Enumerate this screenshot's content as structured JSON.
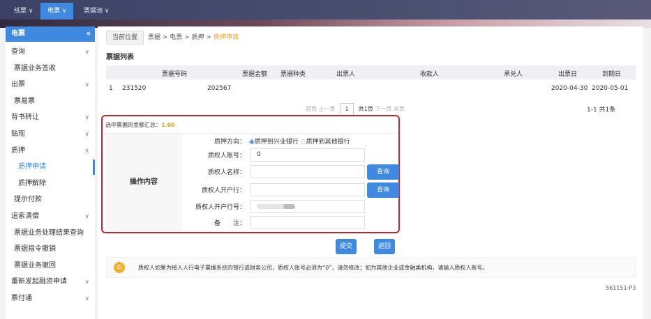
{
  "topnav": [
    {
      "label": "纸票"
    },
    {
      "label": "电票"
    },
    {
      "label": "票据池"
    }
  ],
  "sidebar": {
    "title": "电票",
    "collapse_icon": "«",
    "items": [
      {
        "label": "查询",
        "chev": true
      },
      {
        "label": "票据业务签收"
      },
      {
        "label": "出票",
        "chev": true
      },
      {
        "label": "票易票"
      },
      {
        "label": "背书转让",
        "chev": true
      },
      {
        "label": "贴现",
        "chev": true
      },
      {
        "label": "质押",
        "chev": true,
        "open": true
      },
      {
        "label": "质押申请",
        "active": true
      },
      {
        "label": "质押解除"
      },
      {
        "label": "提示付款"
      },
      {
        "label": "追索清偿",
        "chev": true
      },
      {
        "label": "票据业务处理结果查询"
      },
      {
        "label": "票据指令撤销"
      },
      {
        "label": "票据业务撤回"
      },
      {
        "label": "重新发起融资申请",
        "chev": true
      },
      {
        "label": "票付通",
        "chev": true
      }
    ]
  },
  "breadcrumb": {
    "here": "当前位置",
    "path": "票据 > 电票 > 质押 > ",
    "current": "质押申请"
  },
  "table": {
    "title": "票据列表",
    "headers": [
      "票据号码",
      "票据金额",
      "票据种类",
      "出票人",
      "收款人",
      "承兑人",
      "出票日",
      "到期日"
    ],
    "rows": [
      {
        "idx": "1",
        "no_start": "231520",
        "no_end": "202567",
        "issue": "2020-04-30",
        "due": "2020-05-01"
      }
    ]
  },
  "pager": {
    "first": "首页",
    "prev": "上一页",
    "page": "1",
    "total": "共1页",
    "next": "下一页",
    "last": "末页",
    "summary": "1-1  共1条"
  },
  "form": {
    "sum_label": "选中票据的金额汇总：",
    "sum_value": "1.00",
    "section": "操作内容",
    "direction_label": "质押方向：",
    "opt1": "质押到兴业银行",
    "opt2": "质押到其他银行",
    "account_label": "质权人账号：",
    "account_value": "0",
    "name_label": "质权人名称：",
    "bank_label": "质权人开户行：",
    "bankno_label": "质权人开户行号：",
    "remark_label": "备　　注：",
    "query": "查询"
  },
  "actions": {
    "submit": "提交",
    "back": "返回"
  },
  "notice": "质权人如果为接入人行电子票据系统的银行或财务公司，质权人账号必须为“0”，请勿修改；如为其他企业或金融类机构，请输入质权人账号。",
  "page_code": "561151-P3"
}
